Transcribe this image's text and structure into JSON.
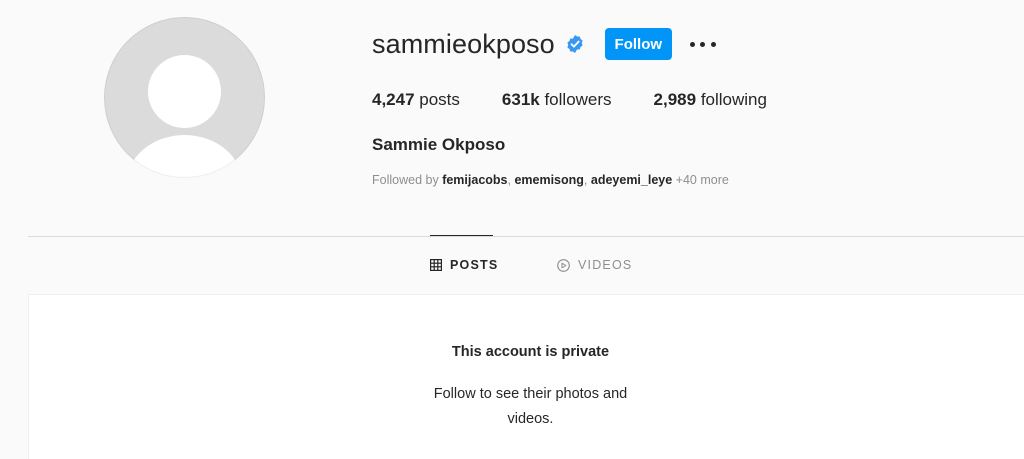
{
  "profile": {
    "username": "sammieokposo",
    "verified": true,
    "follow_label": "Follow",
    "full_name": "Sammie Okposo",
    "stats": {
      "posts_count": "4,247",
      "posts_label": " posts",
      "followers_count": "631k",
      "followers_label": " followers",
      "following_count": "2,989",
      "following_label": " following"
    },
    "followed_by": {
      "prefix": "Followed by ",
      "users": [
        "femijacobs",
        "ememisong",
        "adeyemi_leye"
      ],
      "sep1": ", ",
      "sep2": ", ",
      "more": " +40 more"
    }
  },
  "tabs": {
    "posts_label": "POSTS",
    "videos_label": "VIDEOS",
    "active": "posts"
  },
  "private_notice": {
    "title": "This account is private",
    "line1": "Follow to see their photos and",
    "line2": "videos."
  },
  "colors": {
    "accent": "#0095f6",
    "text": "#262626",
    "muted": "#8e8e8e",
    "background": "#fafafa"
  }
}
